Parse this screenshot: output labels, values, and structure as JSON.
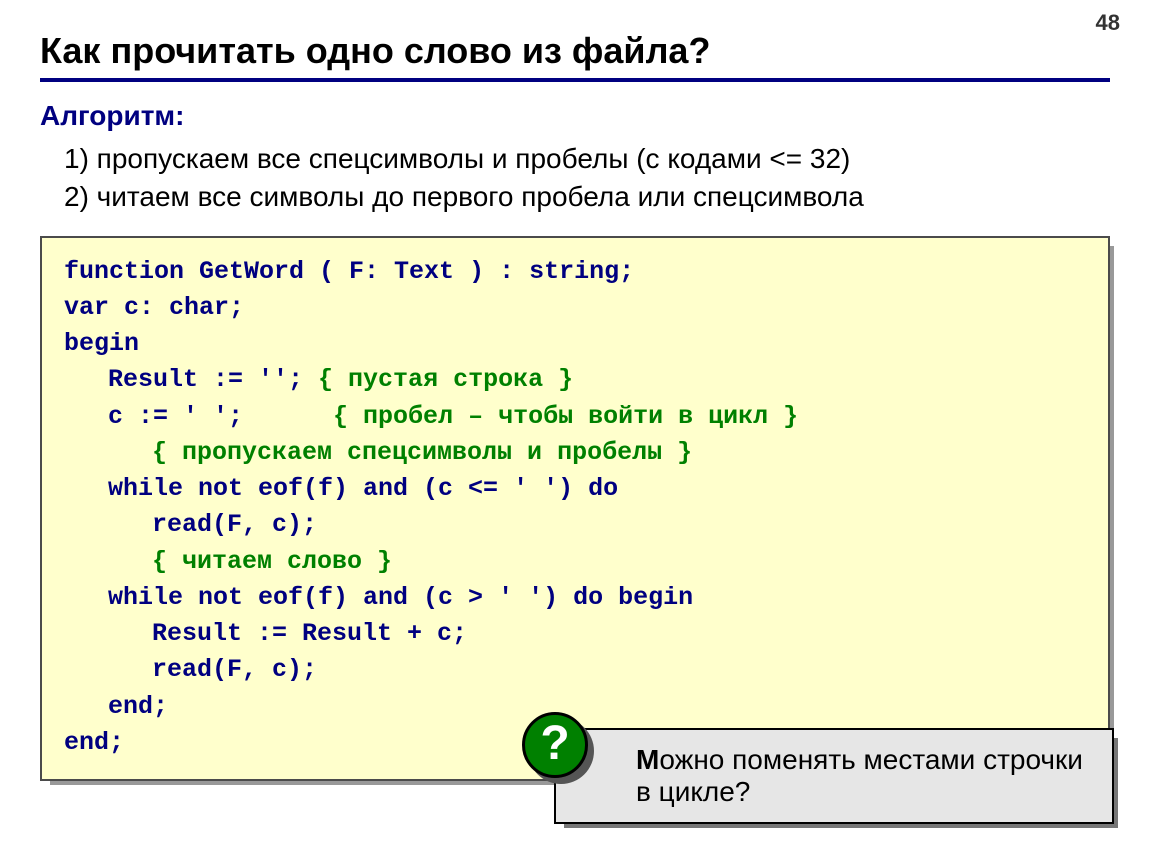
{
  "page_number": "48",
  "title": "Как прочитать одно слово из файла?",
  "algo_heading": "Алгоритм:",
  "algo_item1": "1) пропускаем все спецсимволы и пробелы (с кодами <= 32)",
  "algo_item2": "2) читаем все символы до первого пробела или спецсимвола",
  "code": {
    "l1": "function GetWord ( F: Text ) : string;",
    "l2": "var c: char;",
    "l3": "begin",
    "l4a": "Result := ''; ",
    "l4b": "{ пустая строка }",
    "l5a": "c := ' ';      ",
    "l5b": "{ пробел – чтобы войти в цикл }",
    "l6": "{ пропускаем спецсимволы и пробелы }",
    "l7": "while not eof(f) and (c <= ' ') do",
    "l8": "read(F, c);",
    "l9": "{ читаем слово }",
    "l10": "while not eof(f) and (c > ' ') do begin",
    "l11": "Result := Result + c;",
    "l12": "read(F, c);",
    "l13": "end;",
    "l14": "end;"
  },
  "callout_bold": "М",
  "callout_rest": "ожно поменять местами строчки в цикле?",
  "callout_icon": "?"
}
